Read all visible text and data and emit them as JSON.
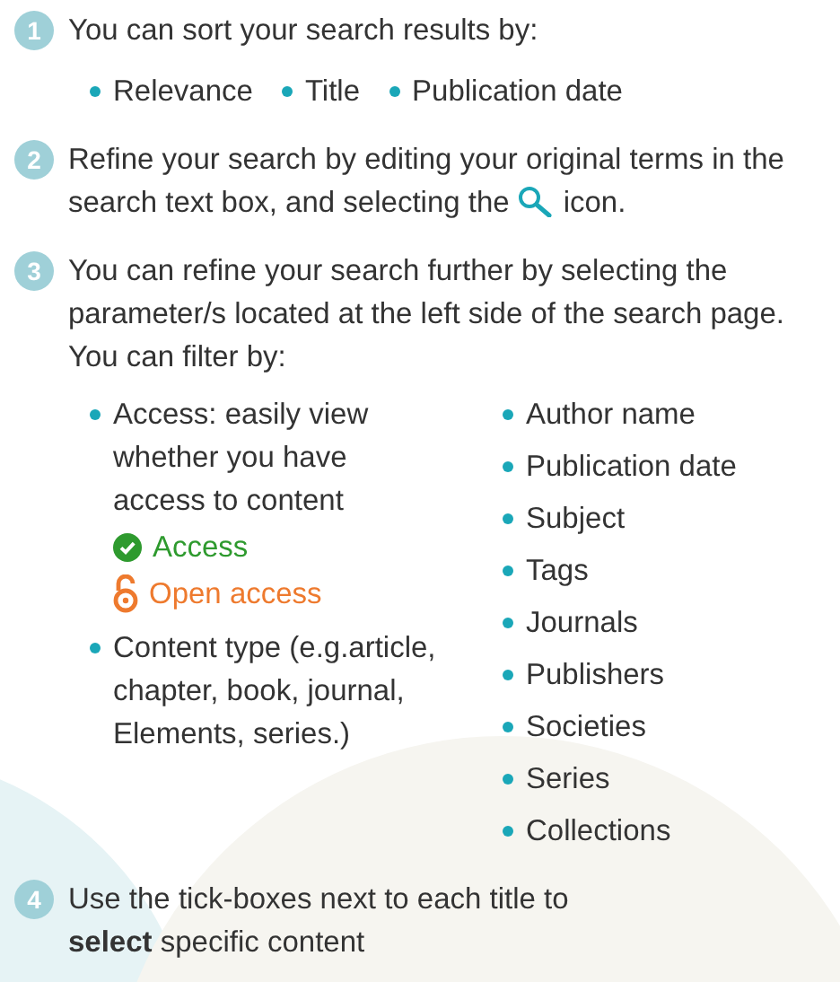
{
  "steps": [
    {
      "number": "1",
      "kind": "sort",
      "text": "You can sort your search results by:",
      "options": [
        "Relevance",
        "Title",
        "Publication date"
      ]
    },
    {
      "number": "2",
      "kind": "refine",
      "text_before": "Refine your search by editing your original terms in the search text box, and selecting the",
      "text_after": "icon."
    },
    {
      "number": "3",
      "kind": "filter",
      "text": "You can refine your search further by selecting the parameter/s located at the left side of the search page. You can filter by:",
      "left_filters": [
        {
          "text": "Access: easily view whether you have access to content",
          "badges": [
            {
              "kind": "access",
              "label": "Access"
            },
            {
              "kind": "open_access",
              "label": "Open access"
            }
          ]
        },
        {
          "text": "Content type (e.g.article, chapter, book, journal, Elements, series.)"
        }
      ],
      "right_filters": [
        "Author name",
        "Publication date",
        "Subject",
        "Tags",
        "Journals",
        "Publishers",
        "Societies",
        "Series",
        "Collections"
      ]
    },
    {
      "number": "4",
      "kind": "text",
      "text": "Use the tick-boxes next to each title to **select** specific content"
    }
  ]
}
